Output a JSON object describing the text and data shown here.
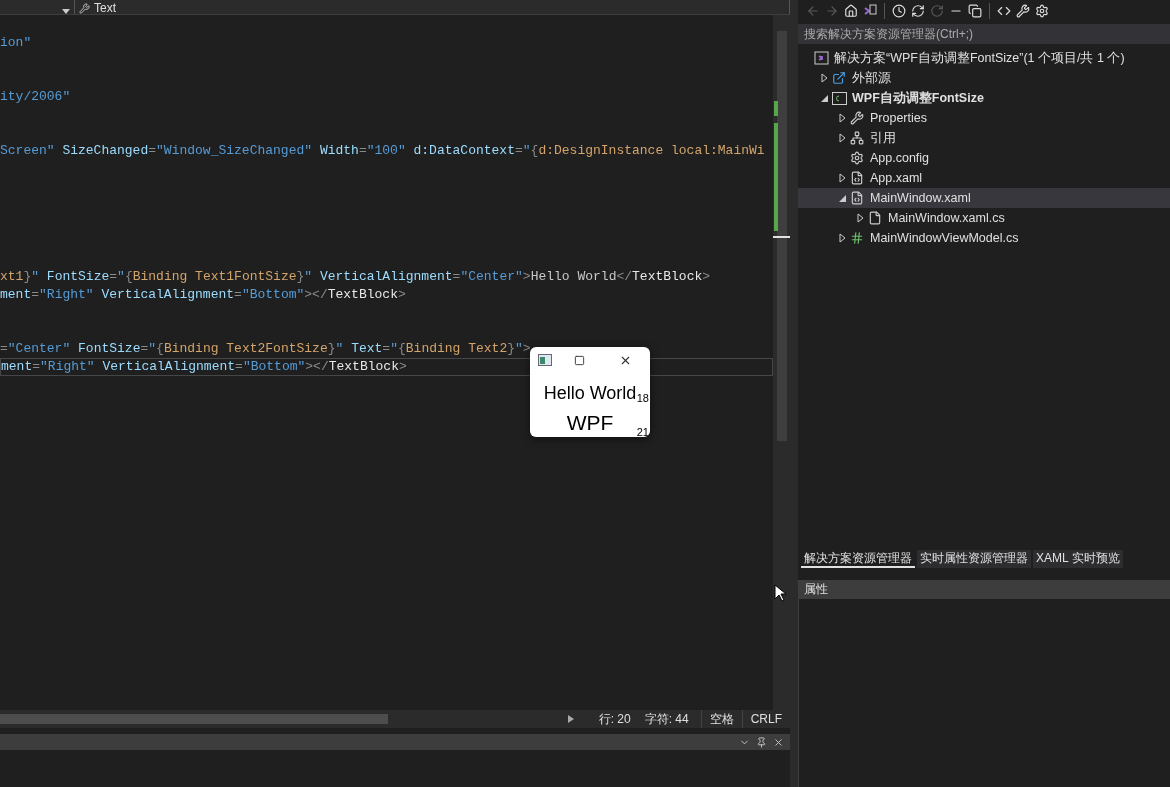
{
  "editor": {
    "nav_bar": {
      "member": "Text"
    },
    "lines": [
      {
        "current": false,
        "tokens": [
          {
            "kind": "str",
            "text": "ion\""
          }
        ]
      },
      {
        "current": false,
        "tokens": [
          {
            "kind": "str",
            "text": "ity/2006\""
          }
        ]
      },
      {
        "current": false,
        "tokens": [
          {
            "kind": "str",
            "text": "Screen\""
          },
          {
            "kind": "attr",
            "text": " SizeChanged"
          },
          {
            "kind": "punct",
            "text": "="
          },
          {
            "kind": "str",
            "text": "\"Window_SizeChanged\""
          },
          {
            "kind": "attr",
            "text": " Width"
          },
          {
            "kind": "punct",
            "text": "="
          },
          {
            "kind": "str",
            "text": "\"100\""
          },
          {
            "kind": "attr",
            "text": " d:DataContext"
          },
          {
            "kind": "punct",
            "text": "="
          },
          {
            "kind": "str",
            "text": "\""
          },
          {
            "kind": "punct",
            "text": "{"
          },
          {
            "kind": "ext",
            "text": "d:DesignInstance local:MainWi"
          }
        ]
      },
      {
        "current": false,
        "tokens": [
          {
            "kind": "ext",
            "text": "xt1"
          },
          {
            "kind": "punct",
            "text": "}"
          },
          {
            "kind": "str",
            "text": "\""
          },
          {
            "kind": "attr",
            "text": " FontSize"
          },
          {
            "kind": "punct",
            "text": "="
          },
          {
            "kind": "str",
            "text": "\""
          },
          {
            "kind": "punct",
            "text": "{"
          },
          {
            "kind": "ext",
            "text": "Binding Text1FontSize"
          },
          {
            "kind": "punct",
            "text": "}"
          },
          {
            "kind": "str",
            "text": "\""
          },
          {
            "kind": "attr",
            "text": " VerticalAlignment"
          },
          {
            "kind": "punct",
            "text": "="
          },
          {
            "kind": "str",
            "text": "\"Center\""
          },
          {
            "kind": "punct",
            "text": ">"
          },
          {
            "kind": "content",
            "text": "Hello World"
          },
          {
            "kind": "punct",
            "text": "</"
          },
          {
            "kind": "elem",
            "text": "TextBlock"
          },
          {
            "kind": "punct",
            "text": ">"
          }
        ]
      },
      {
        "current": false,
        "tokens": [
          {
            "kind": "attr",
            "text": "ment"
          },
          {
            "kind": "punct",
            "text": "="
          },
          {
            "kind": "str",
            "text": "\"Right\""
          },
          {
            "kind": "attr",
            "text": " VerticalAlignment"
          },
          {
            "kind": "punct",
            "text": "="
          },
          {
            "kind": "str",
            "text": "\"Bottom\""
          },
          {
            "kind": "punct",
            "text": "></"
          },
          {
            "kind": "elem",
            "text": "TextBlock"
          },
          {
            "kind": "punct",
            "text": ">"
          }
        ]
      },
      {
        "current": false,
        "tokens": [
          {
            "kind": "punct",
            "text": "="
          },
          {
            "kind": "str",
            "text": "\"Center\""
          },
          {
            "kind": "attr",
            "text": " FontSize"
          },
          {
            "kind": "punct",
            "text": "="
          },
          {
            "kind": "str",
            "text": "\""
          },
          {
            "kind": "punct",
            "text": "{"
          },
          {
            "kind": "ext",
            "text": "Binding Text2FontSize"
          },
          {
            "kind": "punct",
            "text": "}"
          },
          {
            "kind": "str",
            "text": "\""
          },
          {
            "kind": "attr",
            "text": " Text"
          },
          {
            "kind": "punct",
            "text": "="
          },
          {
            "kind": "str",
            "text": "\""
          },
          {
            "kind": "punct",
            "text": "{"
          },
          {
            "kind": "ext",
            "text": "Binding Text2"
          },
          {
            "kind": "punct",
            "text": "}"
          },
          {
            "kind": "str",
            "text": "\""
          },
          {
            "kind": "punct",
            "text": ">"
          }
        ]
      },
      {
        "current": true,
        "tokens": [
          {
            "kind": "attr",
            "text": "ment"
          },
          {
            "kind": "punct",
            "text": "="
          },
          {
            "kind": "str",
            "text": "\"Right\""
          },
          {
            "kind": "attr",
            "text": " VerticalAlignment"
          },
          {
            "kind": "punct",
            "text": "="
          },
          {
            "kind": "str",
            "text": "\"Bottom\""
          },
          {
            "kind": "punct",
            "text": "></"
          },
          {
            "kind": "elem",
            "text": "TextBlock"
          },
          {
            "kind": "punct",
            "text": ">"
          }
        ]
      }
    ],
    "status_bar": {
      "line": "行: 20",
      "char": "字符: 44",
      "indent": "空格",
      "line_ending": "CRLF"
    }
  },
  "preview_window": {
    "lines": [
      {
        "text": "Hello World",
        "font_size": "18"
      },
      {
        "text": "WPF",
        "font_size": "21"
      }
    ]
  },
  "solution_explorer": {
    "toolbar": [
      {
        "kind": "back",
        "disabled": true
      },
      {
        "kind": "forward",
        "disabled": true
      },
      {
        "kind": "home",
        "disabled": false
      },
      {
        "kind": "switch-view",
        "disabled": false
      },
      {
        "kind": "history",
        "disabled": false
      },
      {
        "kind": "refresh",
        "disabled": false
      },
      {
        "kind": "stop",
        "disabled": true
      },
      {
        "kind": "collapse",
        "disabled": false
      },
      {
        "kind": "copy",
        "disabled": false
      },
      {
        "kind": "code",
        "disabled": false
      },
      {
        "kind": "properties",
        "disabled": false
      },
      {
        "kind": "preview",
        "disabled": false
      }
    ],
    "search": {
      "placeholder": "搜索解决方案资源管理器(Ctrl+;)"
    },
    "tree": [
      {
        "kind": "solution",
        "label": "解决方案“WPF自动调整FontSize”(1 个项目/共 1 个)",
        "selected": false,
        "children": [
          {
            "kind": "external",
            "label": "外部源",
            "expanded": false,
            "selected": false
          },
          {
            "kind": "project",
            "label": "WPF自动调整FontSize",
            "expanded": true,
            "selected": false,
            "children": [
              {
                "kind": "wrench",
                "label": "Properties",
                "expanded": false,
                "selected": false
              },
              {
                "kind": "references",
                "label": "引用",
                "expanded": false,
                "selected": false
              },
              {
                "kind": "config",
                "label": "App.config",
                "selected": false
              },
              {
                "kind": "xaml",
                "label": "App.xaml",
                "expanded": false,
                "selected": false
              },
              {
                "kind": "xaml",
                "label": "MainWindow.xaml",
                "expanded": true,
                "selected": true,
                "children": [
                  {
                    "kind": "file",
                    "label": "MainWindow.xaml.cs",
                    "expanded": false,
                    "selected": false
                  }
                ]
              },
              {
                "kind": "csharp",
                "label": "MainWindowViewModel.cs",
                "expanded": false,
                "selected": false
              }
            ]
          }
        ]
      }
    ],
    "tabs": [
      {
        "label": "解决方案资源管理器",
        "selected": true
      },
      {
        "label": "实时属性资源管理器",
        "selected": false
      },
      {
        "label": "XAML 实时预览",
        "selected": false
      }
    ]
  },
  "properties_panel": {
    "title": "属性"
  }
}
